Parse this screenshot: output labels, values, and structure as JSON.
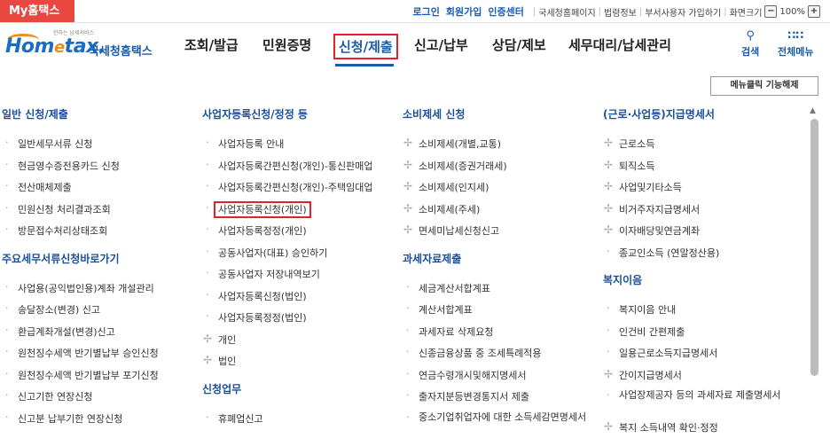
{
  "top": {
    "badge": "My홈택스",
    "links": [
      "로그인",
      "회원가입",
      "인증센터"
    ],
    "utilities": [
      "국세청홈페이지",
      "법령정보",
      "부서사용자 가입하기",
      "화면크기"
    ],
    "zoom_minus": "−",
    "zoom_value": "100%",
    "zoom_plus": "+"
  },
  "logo": {
    "tiny": "한하는 납세서비스",
    "brand_pre": "Hom",
    "brand_e": "e",
    "brand_post": "tax.",
    "korean": "국세청홈택스"
  },
  "nav": {
    "items": [
      "조회/발급",
      "민원증명",
      "신청/제출",
      "신고/납부",
      "상담/제보",
      "세무대리/납세관리"
    ],
    "search_label": "검색",
    "menu_label": "전체메뉴"
  },
  "menu_click_button": "메뉴클릭 기능해제",
  "columns": [
    {
      "title": "일반 신청/제출",
      "items": [
        "일반세무서류 신청",
        "현금영수증전용카드 신청",
        "전산매체제출",
        "민원신청 처리결과조회",
        "방문접수처리상태조회"
      ],
      "title2": "주요세무서류신청바로가기",
      "items2": [
        "사업용(공익법인용)계좌 개설관리",
        "송달장소(변경) 신고",
        "환급계좌개설(변경)신고",
        "원천징수세액 반기별납부 승인신청",
        "원천징수세액 반기별납부 포기신청",
        "신고기한 연장신청",
        "신고분 납부기한 연장신청"
      ]
    },
    {
      "title": "사업자등록신청/정정 등",
      "items": [
        "사업자등록 안내",
        "사업자등록간편신청(개인)-통신판매업",
        "사업자등록간편신청(개인)-주택임대업",
        "사업자등록신청(개인)",
        "사업자등록정정(개인)",
        "공동사업자(대표) 승인하기",
        "공동사업자 저장내역보기",
        "사업자등록신청(법인)",
        "사업자등록정정(법인)",
        "개인",
        "법인"
      ],
      "title2": "신청업무",
      "items2": [
        "휴폐업신고"
      ]
    },
    {
      "title": "소비제세 신청",
      "items": [
        "소비제세(개별,교통)",
        "소비제세(증권거래세)",
        "소비제세(인지세)",
        "소비제세(주세)",
        "면세미납세신청신고"
      ],
      "title2": "과세자료제출",
      "items2": [
        "세금계산서합계표",
        "계산서합계표",
        "과세자료 삭제요청",
        "신종금융상품 중 조세특례적용",
        "연금수령개시및해지명세서",
        "출자지분등변경통지서 제출",
        "중소기업취업자에 대한 소득세감면명세서"
      ]
    },
    {
      "title": "(근로·사업등)지급명세서",
      "items": [
        "근로소득",
        "퇴직소득",
        "사업및기타소득",
        "비거주자지급명세서",
        "이자배당및연금계좌",
        "종교인소득 (연말정산용)"
      ],
      "title2": "복지이음",
      "items2": [
        "복지이음 안내",
        "인건비 간편제출",
        "일용근로소득지급명세서",
        "간이지급명세서",
        "사업장제공자 등의 과세자료 제출명세서",
        "복지 소득내역 확인·정정"
      ]
    }
  ]
}
